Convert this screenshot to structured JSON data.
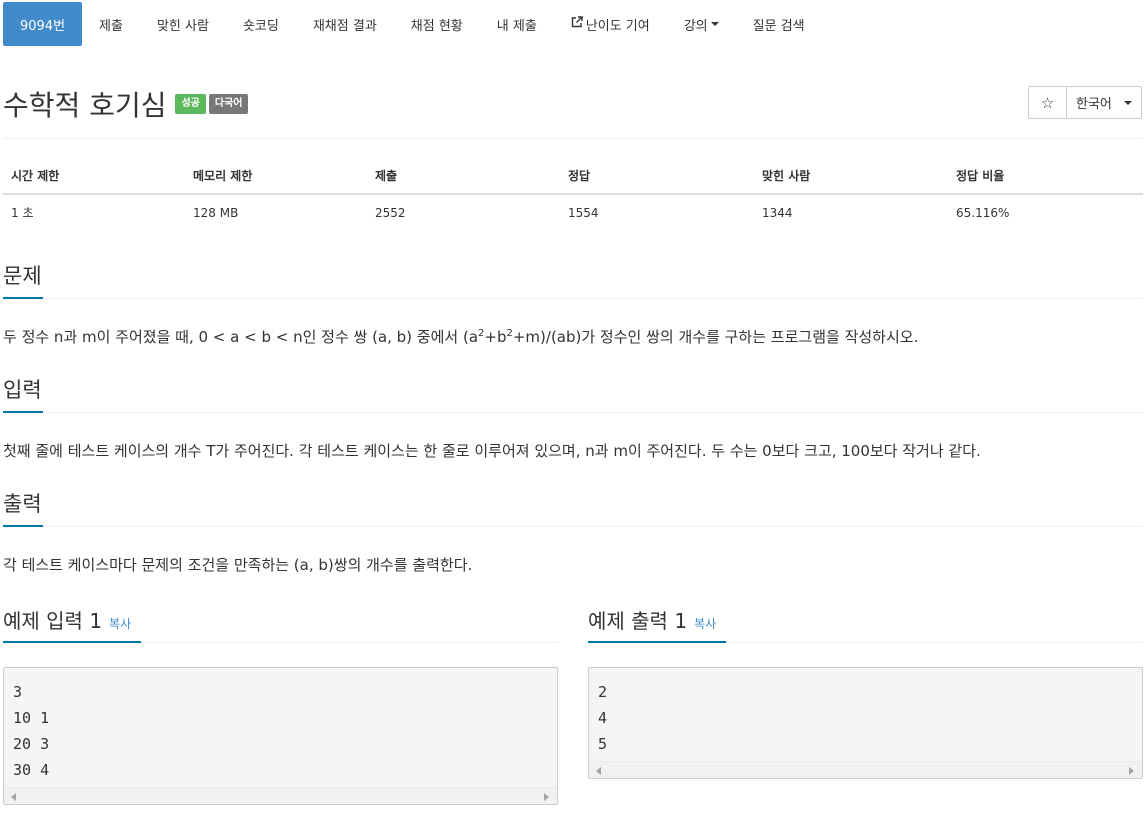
{
  "nav": {
    "items": [
      {
        "label": "9094번",
        "active": true
      },
      {
        "label": "제출"
      },
      {
        "label": "맞힌 사람"
      },
      {
        "label": "숏코딩"
      },
      {
        "label": "재채점 결과"
      },
      {
        "label": "채점 현황"
      },
      {
        "label": "내 제출"
      },
      {
        "label": "난이도 기여",
        "icon": "external-link-icon"
      },
      {
        "label": "강의",
        "dropdown": true
      },
      {
        "label": "질문 검색"
      }
    ]
  },
  "problem": {
    "title": "수학적 호기심",
    "labels": {
      "success": "성공",
      "multilang": "다국어"
    },
    "star_icon": "☆",
    "language": "한국어"
  },
  "info": {
    "headers": [
      "시간 제한",
      "메모리 제한",
      "제출",
      "정답",
      "맞힌 사람",
      "정답 비율"
    ],
    "values": [
      "1 초",
      "128 MB",
      "2552",
      "1554",
      "1344",
      "65.116%"
    ]
  },
  "sections": {
    "problem": {
      "heading": "문제",
      "text_before": "두 정수 n과 m이 주어졌을 때, 0 < a < b < n인 정수 쌍 (a, b) 중에서 (a",
      "sup1": "2",
      "text_mid": "+b",
      "sup2": "2",
      "text_after": "+m)/(ab)가 정수인 쌍의 개수를 구하는 프로그램을 작성하시오."
    },
    "input": {
      "heading": "입력",
      "text": "첫째 줄에 테스트 케이스의 개수 T가 주어진다. 각 테스트 케이스는 한 줄로 이루어져 있으며, n과 m이 주어진다. 두 수는 0보다 크고, 100보다 작거나 같다."
    },
    "output": {
      "heading": "출력",
      "text": "각 테스트 케이스마다 문제의 조건을 만족하는 (a, b)쌍의 개수를 출력한다."
    }
  },
  "samples": {
    "input": {
      "heading": "예제 입력 1",
      "copy": "복사",
      "lines": [
        "3",
        "10 1",
        "20 3",
        "30 4"
      ]
    },
    "output": {
      "heading": "예제 출력 1",
      "copy": "복사",
      "lines": [
        "2",
        "4",
        "5"
      ]
    }
  },
  "colors": {
    "nav_active": "#428bca",
    "success": "#5cb85c",
    "default_label": "#777777",
    "heading_underline": "#0077aa",
    "link": "#428bca"
  }
}
